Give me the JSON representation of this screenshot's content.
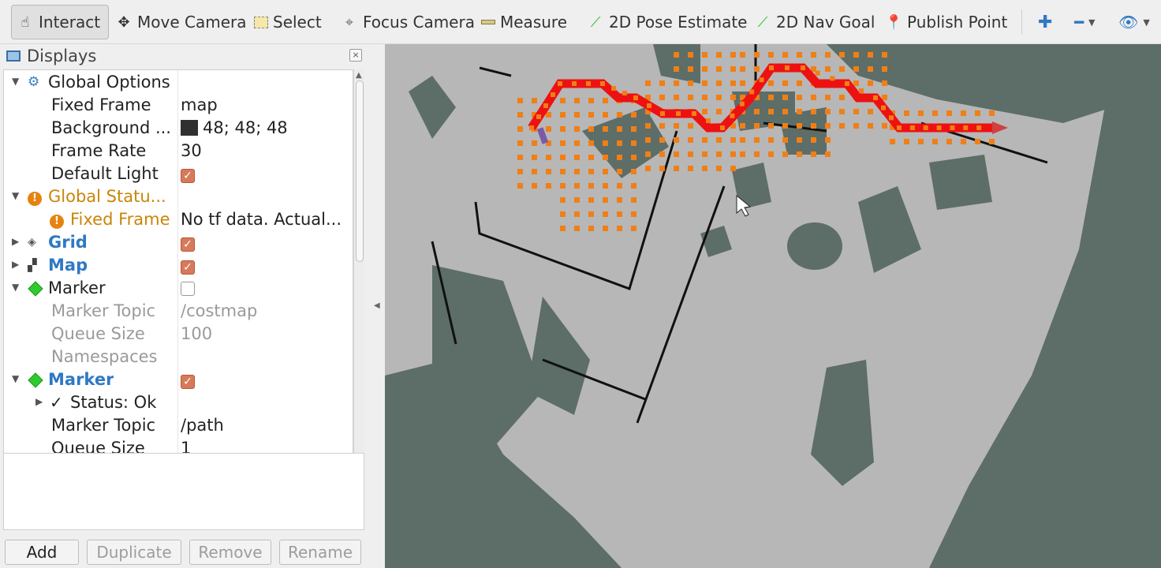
{
  "toolbar": {
    "tools": [
      {
        "label": "Interact",
        "icon": "hand-icon"
      },
      {
        "label": "Move Camera",
        "icon": "move-icon"
      },
      {
        "label": "Select",
        "icon": "select-icon"
      },
      {
        "label": "Focus Camera",
        "icon": "focus-icon"
      },
      {
        "label": "Measure",
        "icon": "ruler-icon"
      },
      {
        "label": "2D Pose Estimate",
        "icon": "green-arrow-icon"
      },
      {
        "label": "2D Nav Goal",
        "icon": "green-arrow-icon"
      },
      {
        "label": "Publish Point",
        "icon": "map-pin-icon"
      }
    ],
    "active_tool": "Interact"
  },
  "displays": {
    "title": "Displays",
    "rows": [
      {
        "name": "Global Options",
        "value": ""
      },
      {
        "name": "Fixed Frame",
        "value": "map"
      },
      {
        "name": "Background ...",
        "value": "48; 48; 48"
      },
      {
        "name": "Frame Rate",
        "value": "30"
      },
      {
        "name": "Default Light",
        "value": ""
      },
      {
        "name": "Global Statu...",
        "value": ""
      },
      {
        "name": "Fixed Frame",
        "value": "No tf data.  Actual..."
      },
      {
        "name": "Grid",
        "value": ""
      },
      {
        "name": "Map",
        "value": ""
      },
      {
        "name": "Marker",
        "value": ""
      },
      {
        "name": "Marker Topic",
        "value": "/costmap"
      },
      {
        "name": "Queue Size",
        "value": "100"
      },
      {
        "name": "Namespaces",
        "value": ""
      },
      {
        "name": "Marker",
        "value": ""
      },
      {
        "name": "Status: Ok",
        "value": ""
      },
      {
        "name": "Marker Topic",
        "value": "/path"
      },
      {
        "name": "Queue Size",
        "value": "1"
      }
    ]
  },
  "buttons": {
    "add": "Add",
    "duplicate": "Duplicate",
    "remove": "Remove",
    "rename": "Rename"
  },
  "colors": {
    "path": "#ee1111",
    "costmap": "#f07f16",
    "map_free": "#b7b7b7",
    "map_unknown": "#5d6d67",
    "checkbox": "#d77a5a"
  }
}
